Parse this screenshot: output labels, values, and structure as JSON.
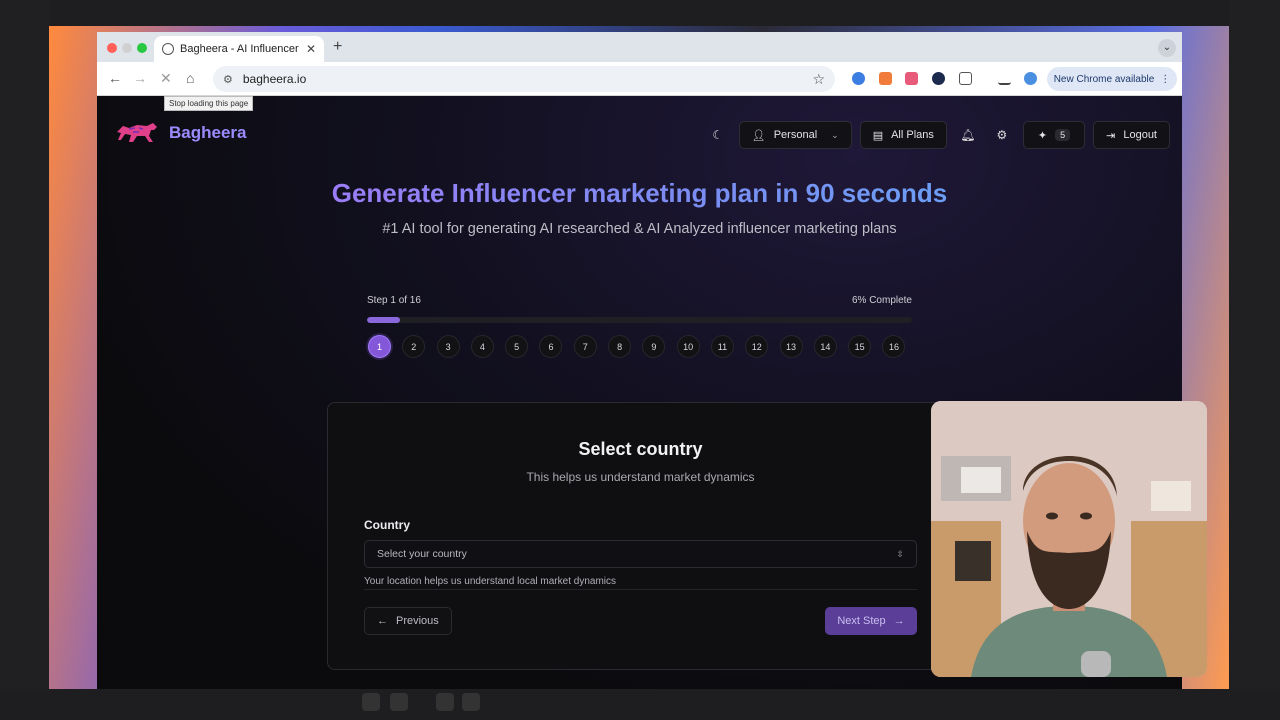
{
  "browser": {
    "tab_title": "Bagheera - AI Influencer Mar",
    "url": "bagheera.io",
    "tooltip": "Stop loading this page",
    "update_label": "New Chrome available"
  },
  "header": {
    "brand": "Bagheera",
    "workspace": "Personal",
    "plans": "All Plans",
    "credits": "5",
    "logout": "Logout"
  },
  "hero": {
    "title": "Generate Influencer marketing plan in 90 seconds",
    "subtitle": "#1 AI tool for generating AI researched & AI Analyzed influencer marketing plans"
  },
  "progress": {
    "step_label": "Step 1 of 16",
    "percent_label": "6% Complete",
    "fraction": 0.06,
    "current_step": 1,
    "steps": [
      "1",
      "2",
      "3",
      "4",
      "5",
      "6",
      "7",
      "8",
      "9",
      "10",
      "11",
      "12",
      "13",
      "14",
      "15",
      "16"
    ]
  },
  "form": {
    "title": "Select country",
    "subtitle": "This helps us understand market dynamics",
    "field_label": "Country",
    "select_placeholder": "Select your country",
    "help_text": "Your location helps us understand local market dynamics",
    "previous": "Previous",
    "next": "Next Step"
  },
  "colors": {
    "accent": "#8457d9",
    "brand": "#9a8cff",
    "next_button": "#5a3e98"
  }
}
